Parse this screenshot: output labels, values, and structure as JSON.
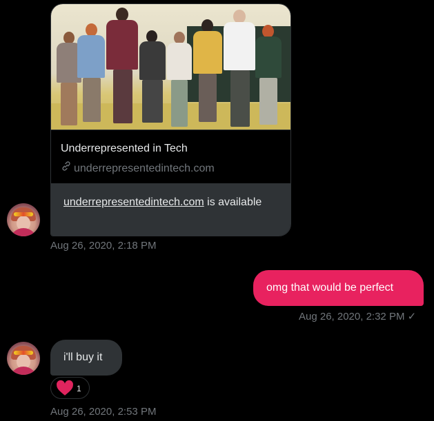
{
  "messages": {
    "link_card": {
      "title": "Underrepresented in Tech",
      "domain": "underrepresentedintech.com",
      "text_link": "underrepresentedintech.com",
      "text_rest": " is available",
      "timestamp": "Aug 26, 2020, 2:18 PM"
    },
    "outgoing": {
      "text": "omg that would be perfect",
      "timestamp": "Aug 26, 2020, 2:32 PM",
      "status_mark": "✓"
    },
    "incoming": {
      "text": "i'll buy it",
      "reaction_count": "1",
      "reaction_icon": "heart-icon",
      "timestamp": "Aug 26, 2020, 2:53 PM"
    }
  },
  "colors": {
    "background": "#000000",
    "outgoing_bubble": "#e8225f",
    "incoming_bubble": "#2f3336",
    "secondary_text": "#71767b",
    "reaction_heart": "#e0245e"
  }
}
